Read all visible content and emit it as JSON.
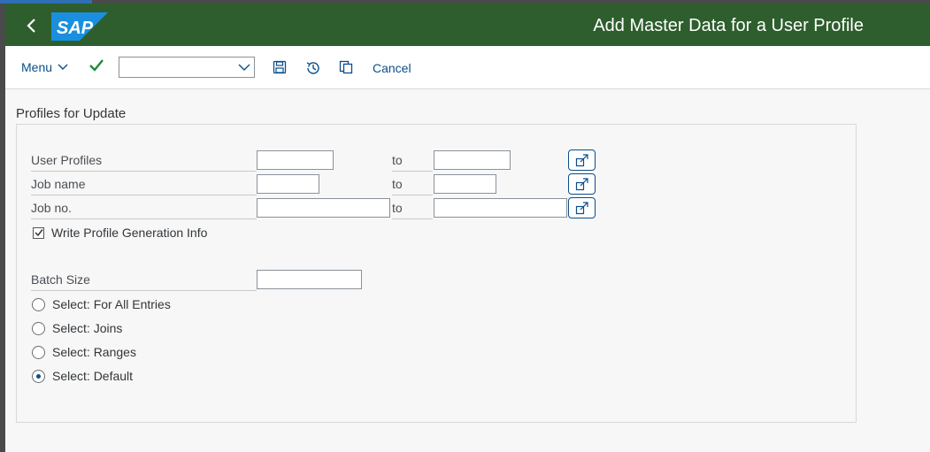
{
  "shell": {
    "title": "Add Master Data for a User Profile",
    "logo_text": "SAP",
    "colors": {
      "shellbar": "#2e5e2d",
      "accent": "#0a4e8c",
      "logo": "#1a8fe0"
    }
  },
  "toolbar": {
    "menu_label": "Menu",
    "dropdown_value": "",
    "cancel_label": "Cancel",
    "icons": [
      "check-icon",
      "save-icon",
      "history-icon",
      "copy-icon"
    ]
  },
  "form": {
    "section_title": "Profiles for Update",
    "rows": [
      {
        "label": "User Profiles",
        "from": "",
        "to_label": "to",
        "to": ""
      },
      {
        "label": "Job name",
        "from": "",
        "to_label": "to",
        "to": ""
      },
      {
        "label": "Job no.",
        "from": "",
        "to_label": "to",
        "to": ""
      }
    ],
    "write_profile_label": "Write Profile Generation Info",
    "write_profile_checked": true,
    "batch_size_label": "Batch Size",
    "batch_size_value": "",
    "radios": [
      {
        "label": "Select: For All Entries",
        "selected": false
      },
      {
        "label": "Select: Joins",
        "selected": false
      },
      {
        "label": "Select: Ranges",
        "selected": false
      },
      {
        "label": "Select: Default",
        "selected": true
      }
    ]
  }
}
